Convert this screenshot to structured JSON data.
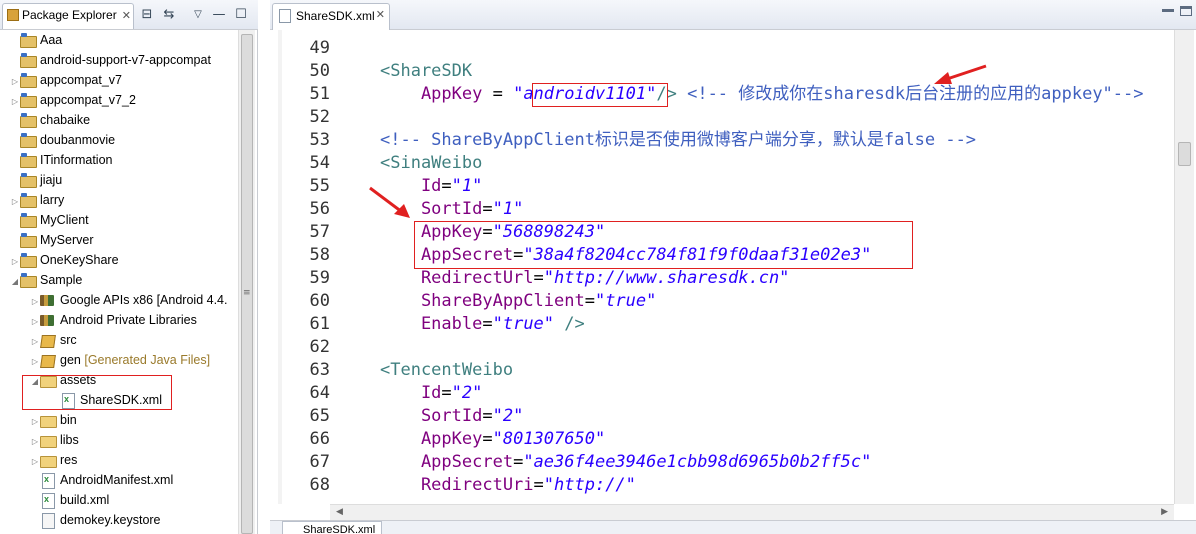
{
  "package_explorer": {
    "title": "Package Explorer",
    "close": "✕",
    "toolbar": {
      "collapse": "⊟",
      "link": "⇆",
      "menu": "▽",
      "minimize": "—",
      "maximize": "☐"
    },
    "items": [
      {
        "label": "Aaa",
        "icon": "project-icon"
      },
      {
        "label": "android-support-v7-appcompat",
        "icon": "project-icon"
      },
      {
        "label": "appcompat_v7",
        "icon": "project-icon"
      },
      {
        "label": "appcompat_v7_2",
        "icon": "project-icon"
      },
      {
        "label": "chabaike",
        "icon": "project-icon"
      },
      {
        "label": "doubanmovie",
        "icon": "project-icon"
      },
      {
        "label": "ITinformation",
        "icon": "project-icon"
      },
      {
        "label": "jiaju",
        "icon": "project-icon"
      },
      {
        "label": "larry",
        "icon": "project-icon"
      },
      {
        "label": "MyClient",
        "icon": "project-icon"
      },
      {
        "label": "MyServer",
        "icon": "project-icon"
      },
      {
        "label": "OneKeyShare",
        "icon": "project-icon"
      },
      {
        "label": "Sample",
        "icon": "project-icon"
      },
      {
        "label": "Google APIs x86 [Android 4.4.",
        "icon": "library-icon"
      },
      {
        "label": "Android Private Libraries",
        "icon": "library-icon"
      },
      {
        "label": "src",
        "icon": "package-icon"
      },
      {
        "label": "gen",
        "suffix": "[Generated Java Files]",
        "icon": "package-icon"
      },
      {
        "label": "assets",
        "icon": "folder-icon"
      },
      {
        "label": "ShareSDK.xml",
        "icon": "xml-file-icon"
      },
      {
        "label": "bin",
        "icon": "folder-icon"
      },
      {
        "label": "libs",
        "icon": "folder-icon"
      },
      {
        "label": "res",
        "icon": "folder-icon"
      },
      {
        "label": "AndroidManifest.xml",
        "icon": "xml-file-icon"
      },
      {
        "label": "build.xml",
        "icon": "xml-file-icon"
      },
      {
        "label": "demokey.keystore",
        "icon": "file-icon"
      }
    ]
  },
  "editor": {
    "tab_label": "ShareSDK.xml",
    "tab_close": "✕",
    "bottom_tab": "ShareSDK.xml",
    "lines": [
      {
        "num": "49",
        "parts": []
      },
      {
        "num": "50",
        "parts": [
          [
            "tg",
            "<ShareSDK"
          ]
        ]
      },
      {
        "num": "51",
        "parts": [
          [
            "at",
            "    AppKey "
          ],
          [
            "eq",
            "= "
          ],
          [
            "vl",
            "\"androidv1101\""
          ],
          [
            "tg",
            "/> "
          ],
          [
            "cm",
            "<!-- 修改成你在sharesdk后台注册的应用的appkey\"-->"
          ]
        ]
      },
      {
        "num": "52",
        "parts": []
      },
      {
        "num": "53",
        "parts": [
          [
            "cm",
            "<!-- ShareByAppClient标识是否使用微博客户端分享，默认是false -->"
          ]
        ]
      },
      {
        "num": "54",
        "parts": [
          [
            "tg",
            "<SinaWeibo"
          ]
        ]
      },
      {
        "num": "55",
        "parts": [
          [
            "at",
            "    Id"
          ],
          [
            "eq",
            "="
          ],
          [
            "vl",
            "\"1\""
          ]
        ]
      },
      {
        "num": "56",
        "parts": [
          [
            "at",
            "    SortId"
          ],
          [
            "eq",
            "="
          ],
          [
            "vl",
            "\"1\""
          ]
        ]
      },
      {
        "num": "57",
        "parts": [
          [
            "at",
            "    AppKey"
          ],
          [
            "eq",
            "="
          ],
          [
            "vl",
            "\"568898243\""
          ]
        ]
      },
      {
        "num": "58",
        "parts": [
          [
            "at",
            "    AppSecret"
          ],
          [
            "eq",
            "="
          ],
          [
            "vl",
            "\"38a4f8204cc784f81f9f0daaf31e02e3\""
          ]
        ]
      },
      {
        "num": "59",
        "parts": [
          [
            "at",
            "    RedirectUrl"
          ],
          [
            "eq",
            "="
          ],
          [
            "vl",
            "\"http://www.sharesdk.cn\""
          ]
        ]
      },
      {
        "num": "60",
        "parts": [
          [
            "at",
            "    ShareByAppClient"
          ],
          [
            "eq",
            "="
          ],
          [
            "vl",
            "\"true\""
          ]
        ]
      },
      {
        "num": "61",
        "parts": [
          [
            "at",
            "    Enable"
          ],
          [
            "eq",
            "="
          ],
          [
            "vl",
            "\"true\""
          ],
          [
            "tg",
            " />"
          ]
        ]
      },
      {
        "num": "62",
        "parts": []
      },
      {
        "num": "63",
        "parts": [
          [
            "tg",
            "<TencentWeibo"
          ]
        ]
      },
      {
        "num": "64",
        "parts": [
          [
            "at",
            "    Id"
          ],
          [
            "eq",
            "="
          ],
          [
            "vl",
            "\"2\""
          ]
        ]
      },
      {
        "num": "65",
        "parts": [
          [
            "at",
            "    SortId"
          ],
          [
            "eq",
            "="
          ],
          [
            "vl",
            "\"2\""
          ]
        ]
      },
      {
        "num": "66",
        "parts": [
          [
            "at",
            "    AppKey"
          ],
          [
            "eq",
            "="
          ],
          [
            "vl",
            "\"801307650\""
          ]
        ]
      },
      {
        "num": "67",
        "parts": [
          [
            "at",
            "    AppSecret"
          ],
          [
            "eq",
            "="
          ],
          [
            "vl",
            "\"ae36f4ee3946e1cbb98d6965b0b2ff5c\""
          ]
        ]
      },
      {
        "num": "68",
        "parts": [
          [
            "at",
            "    RedirectUri"
          ],
          [
            "eq",
            "="
          ],
          [
            "vl",
            "\"http://\""
          ]
        ]
      }
    ]
  },
  "colors": {
    "annotation": "#e02020",
    "tag": "#3f7f7f",
    "attribute": "#7f007f",
    "value": "#2a00ff",
    "comment": "#3f5fbf"
  }
}
